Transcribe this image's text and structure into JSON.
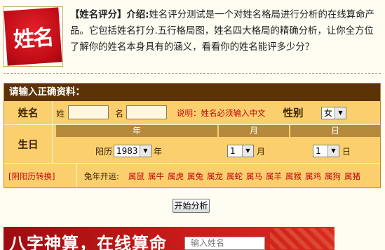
{
  "logo": {
    "text": "姓名"
  },
  "intro": {
    "tag": "【姓名评分】",
    "label": "介绍:",
    "text": "姓名评分测试是一个对姓名格局进行分析的在线算命产品。它包括姓名打分.五行格局图，姓名四大格局的精确分析，让你全方位了解你的姓名本身具有的涵义，看看你的姓名能评多少分？"
  },
  "form": {
    "title": "请输入正确资料：",
    "name_label": "姓名",
    "surname_label": "姓",
    "given_label": "名",
    "surname_value": "",
    "given_value": "",
    "note": "说明：姓名必须输入中文",
    "gender_label": "性别",
    "gender_value": "女",
    "birth_label": "生日",
    "year_head": "年",
    "month_head": "月",
    "day_head": "日",
    "calendar_label": "阳历",
    "year_value": "1983",
    "year_unit": "年",
    "month_value": "1",
    "month_unit": "月",
    "day_value": "1",
    "day_unit": "日",
    "convert_link": "[阴阳历转换]",
    "zodiac_label": "兔年开运:",
    "zodiac": [
      "属鼠",
      "属牛",
      "属虎",
      "属兔",
      "属龙",
      "属蛇",
      "属马",
      "属羊",
      "属猴",
      "属鸡",
      "属狗",
      "属猪"
    ]
  },
  "submit_label": "开始分析",
  "banner": {
    "text": "八字神算，在线算命",
    "input_placeholder": "输入姓名"
  },
  "colors": {
    "title_bar": "#5c3305",
    "form_bg": "#fbcf6e",
    "date_head": "#b58a3d",
    "accent_red": "#c2080e"
  }
}
